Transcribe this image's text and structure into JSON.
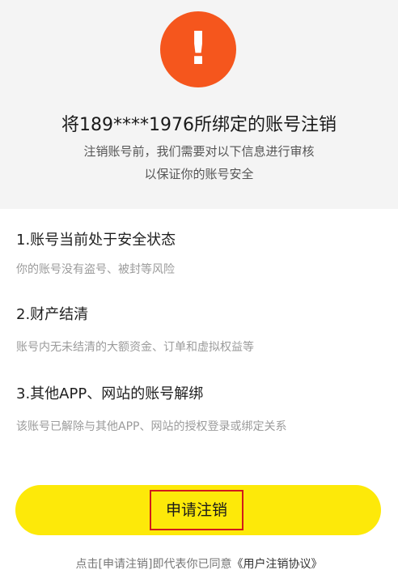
{
  "header": {
    "warning_icon": "exclamation-icon",
    "warning_glyph": "!",
    "warning_color": "#f5561d",
    "title": "将189****1976所绑定的账号注销",
    "subtitle_line1": "注销账号前，我们需要对以下信息进行审核",
    "subtitle_line2": "以保证你的账号安全"
  },
  "checks": [
    {
      "title": "1.账号当前处于安全状态",
      "description": "你的账号没有盗号、被封等风险"
    },
    {
      "title": "2.财产结清",
      "description": "账号内无未结清的大额资金、订单和虚拟权益等"
    },
    {
      "title": "3.其他APP、网站的账号解绑",
      "description": "该账号已解除与其他APP、网站的授权登录或绑定关系"
    }
  ],
  "apply_button": {
    "label": "申请注销",
    "color": "#fde909",
    "highlight_color": "#d11b1b"
  },
  "footer": {
    "prefix": "点击[申请注销]即代表你已同意",
    "agreement_link": "《用户注销协议》"
  }
}
